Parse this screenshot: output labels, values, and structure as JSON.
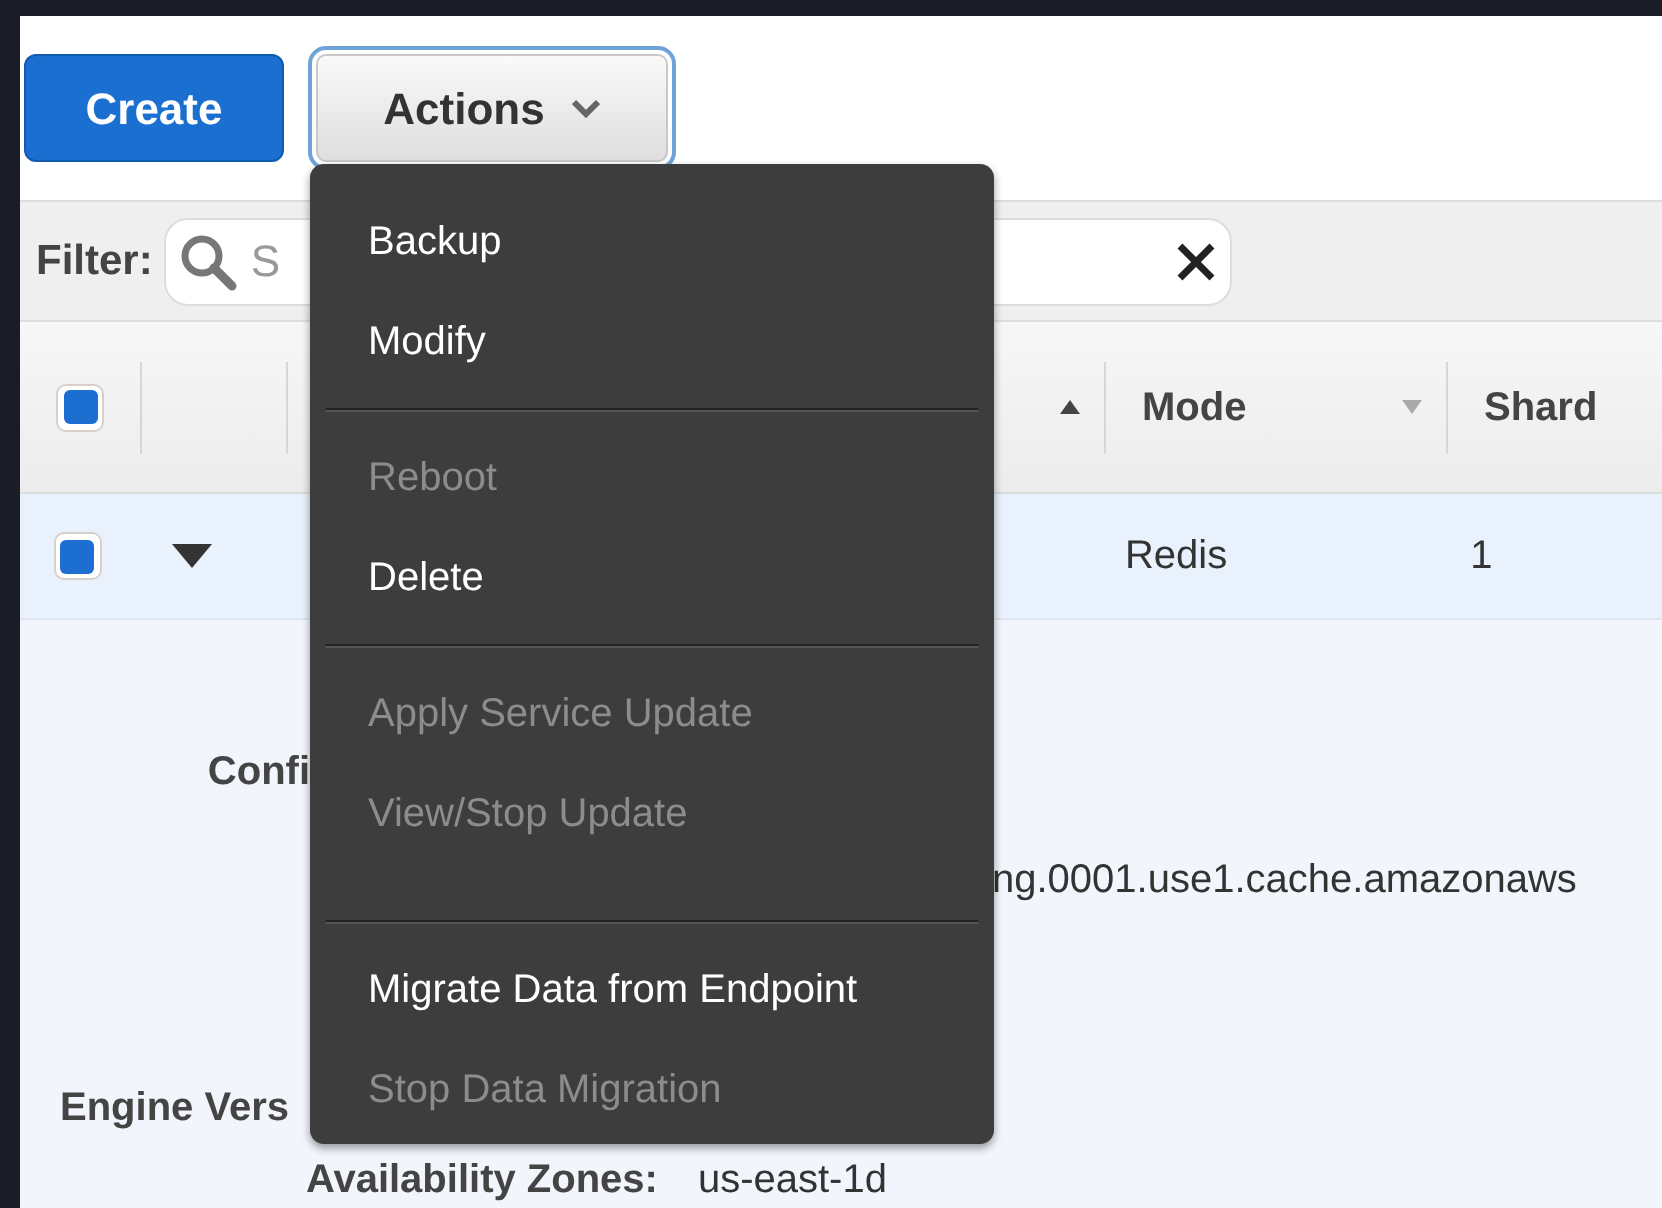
{
  "toolbar": {
    "create_button": "Create",
    "actions_button": {
      "label": "Actions",
      "expanded": true
    }
  },
  "filter": {
    "label": "Filter:",
    "placeholder": "S"
  },
  "table": {
    "select_all_checked": true,
    "columns": [
      {
        "sorted": true
      },
      {
        "label": "Mode",
        "sorted": false
      },
      {
        "label": "Shard"
      }
    ],
    "rows": [
      {
        "checked": true,
        "expanded": true,
        "cells": [
          "",
          "Redis",
          "1"
        ]
      }
    ]
  },
  "details": {
    "config_label": "Confi",
    "endpoint_value": "ng.0001.use1.cache.amazonaws",
    "engine_version_label": "Engine Vers",
    "availability_zones_label": "Availability Zones:",
    "availability_zones_value": "us-east-1d"
  },
  "actions_menu": {
    "groups": [
      [
        {
          "label": "Backup",
          "disabled": false
        },
        {
          "label": "Modify",
          "disabled": false
        }
      ],
      [
        {
          "label": "Reboot",
          "disabled": true
        },
        {
          "label": "Delete",
          "disabled": false
        }
      ],
      [
        {
          "label": "Apply Service Update",
          "disabled": true
        },
        {
          "label": "View/Stop Update",
          "disabled": true
        }
      ],
      [
        {
          "label": "Migrate Data from Endpoint",
          "disabled": false
        },
        {
          "label": "Stop Data Migration",
          "disabled": true
        }
      ]
    ]
  }
}
